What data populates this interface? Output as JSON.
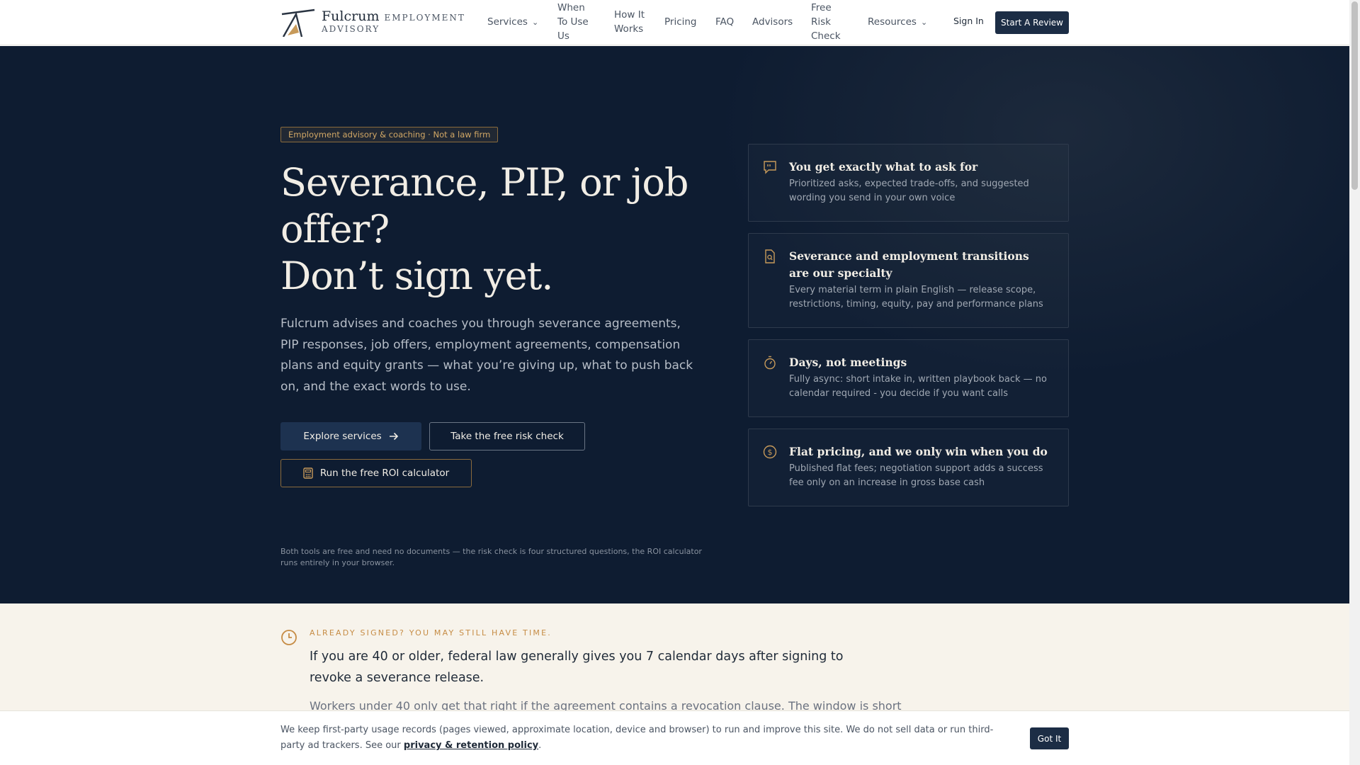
{
  "brand": {
    "name": "Fulcrum",
    "sub1": "EMPLOYMENT",
    "sub2": "ADVISORY"
  },
  "nav": {
    "services": "Services",
    "when1": "When",
    "when2": "To Use",
    "when3": "Us",
    "how1": "How It",
    "how2": "Works",
    "pricing": "Pricing",
    "faq": "FAQ",
    "advisors": "Advisors",
    "risk1": "Free",
    "risk2": "Risk",
    "risk3": "Check",
    "resources": "Resources",
    "signin": "Sign In",
    "cta": "Start A Review"
  },
  "hero": {
    "badge": "Employment advisory & coaching · Not a law firm",
    "headline1": "Severance, PIP, or job",
    "headline2": "offer?",
    "headline3": "Don’t sign yet.",
    "lead": "Fulcrum advises and coaches you through severance agreements, PIP responses, job offers, employment agreements, compensation plans and equity grants — what you’re giving up, what to push back on, and the exact words to use.",
    "btn_explore": "Explore services",
    "btn_risk": "Take the free risk check",
    "btn_roi": "Run the free ROI calculator",
    "note": "Both tools are free and need no documents — the risk check is four structured questions, the ROI calculator runs entirely in your browser."
  },
  "cards": [
    {
      "title": "You get exactly what to ask for",
      "text": "Prioritized asks, expected trade-offs, and suggested wording you send in your own voice",
      "icon": "quote-bubble-icon"
    },
    {
      "title": "Severance and employment transitions are our specialty",
      "text": "Every material term in plain English — release scope, restrictions, timing, equity, pay and performance plans",
      "icon": "document-search-icon"
    },
    {
      "title": "Days, not meetings",
      "text": "Fully async: short intake in, written playbook back — no calendar required - you decide if you want calls",
      "icon": "stopwatch-icon"
    },
    {
      "title": "Flat pricing, and we only win when you do",
      "text": "Published flat fees; negotiation support adds a success fee only on an increase in gross base cash",
      "icon": "dollar-circle-icon"
    }
  ],
  "notice": {
    "eyebrow": "ALREADY SIGNED? YOU MAY STILL HAVE TIME.",
    "main": "If you are 40 or older, federal law generally gives you 7 calendar days after signing to revoke a severance release.",
    "sub": "Workers under 40 only get that right if the agreement contains a revocation clause. The window is short"
  },
  "cookie": {
    "text": "We keep first-party usage records (pages viewed, approximate location, device and browser) to run and improve this site. We do not sell data or run third-party ad trackers. See our",
    "link": "privacy & retention policy",
    "end": ".",
    "button": "Got It"
  },
  "colors": {
    "navy": "#0e1c31",
    "button_navy": "#1c2d45",
    "gold": "#c79a5a",
    "cream": "#f7f3eb"
  }
}
